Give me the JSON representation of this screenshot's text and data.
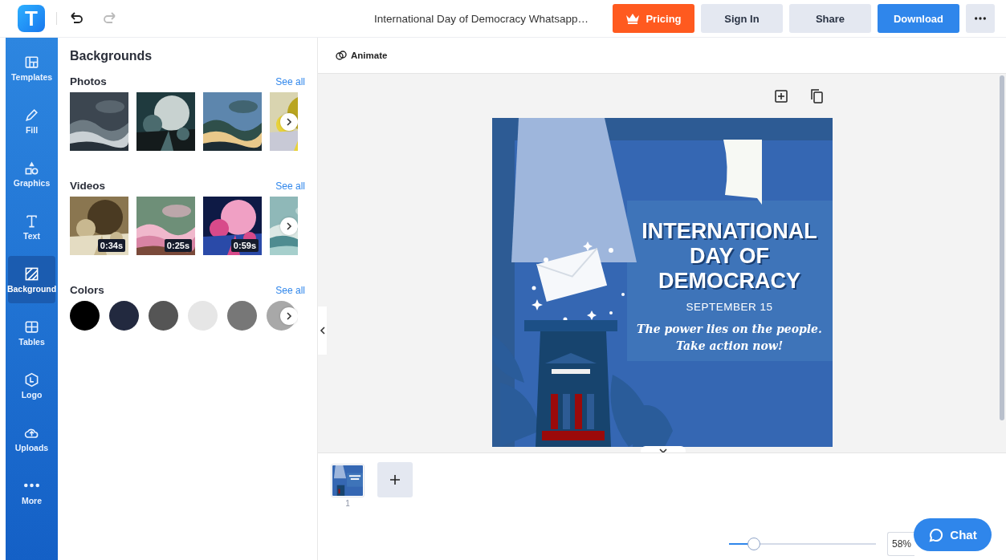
{
  "app": {
    "logo": "T"
  },
  "document": {
    "title": "International Day of Democracy Whatsapp…"
  },
  "header_buttons": [
    {
      "label": "Pricing",
      "kind": "pricing"
    },
    {
      "label": "Sign In",
      "kind": "plain"
    },
    {
      "label": "Share",
      "kind": "plain"
    },
    {
      "label": "Download",
      "kind": "primary"
    }
  ],
  "sidebar": {
    "items": [
      {
        "label": "Templates",
        "kind": "templates",
        "selected": false
      },
      {
        "label": "Fill",
        "kind": "fill",
        "selected": false
      },
      {
        "label": "Graphics",
        "kind": "graphics",
        "selected": false
      },
      {
        "label": "Text",
        "kind": "text",
        "selected": false
      },
      {
        "label": "Background",
        "kind": "background",
        "selected": true
      },
      {
        "label": "Tables",
        "kind": "tables",
        "selected": false
      },
      {
        "label": "Logo",
        "kind": "logo",
        "selected": false
      },
      {
        "label": "Uploads",
        "kind": "uploads",
        "selected": false
      },
      {
        "label": "More",
        "kind": "more",
        "selected": false
      }
    ]
  },
  "panel": {
    "title": "Backgrounds",
    "photos": {
      "title": "Photos",
      "see_all": "See all",
      "items": [
        {
          "kind": "picture"
        },
        {
          "kind": "picture"
        },
        {
          "kind": "picture"
        },
        {
          "kind": "picture"
        }
      ]
    },
    "videos": {
      "title": "Videos",
      "see_all": "See all",
      "items": [
        {
          "kind": "picture",
          "duration": "0:34s"
        },
        {
          "kind": "picture",
          "duration": "0:25s"
        },
        {
          "kind": "picture",
          "duration": "0:59s"
        },
        {
          "kind": "picture"
        }
      ]
    },
    "colors": {
      "title": "Colors",
      "see_all": "See all",
      "items": [
        {
          "color": "#000000"
        },
        {
          "color": "#22293f"
        },
        {
          "color": "#555555"
        },
        {
          "color": "#e6e6e6"
        },
        {
          "color": "#777777"
        },
        {
          "color": "#a8a8a8"
        }
      ]
    }
  },
  "toolbar": {
    "animate": "Animate"
  },
  "design": {
    "title": "INTERNATIONAL\nDAY OF\nDEMOCRACY",
    "date": "SEPTEMBER 15",
    "tagline": "The power lies on the people.\nTake action now!"
  },
  "pages": [
    {
      "number": "1"
    }
  ],
  "zoom": {
    "level": 0.17,
    "value": "58%"
  },
  "chat": {
    "label": "Chat"
  }
}
